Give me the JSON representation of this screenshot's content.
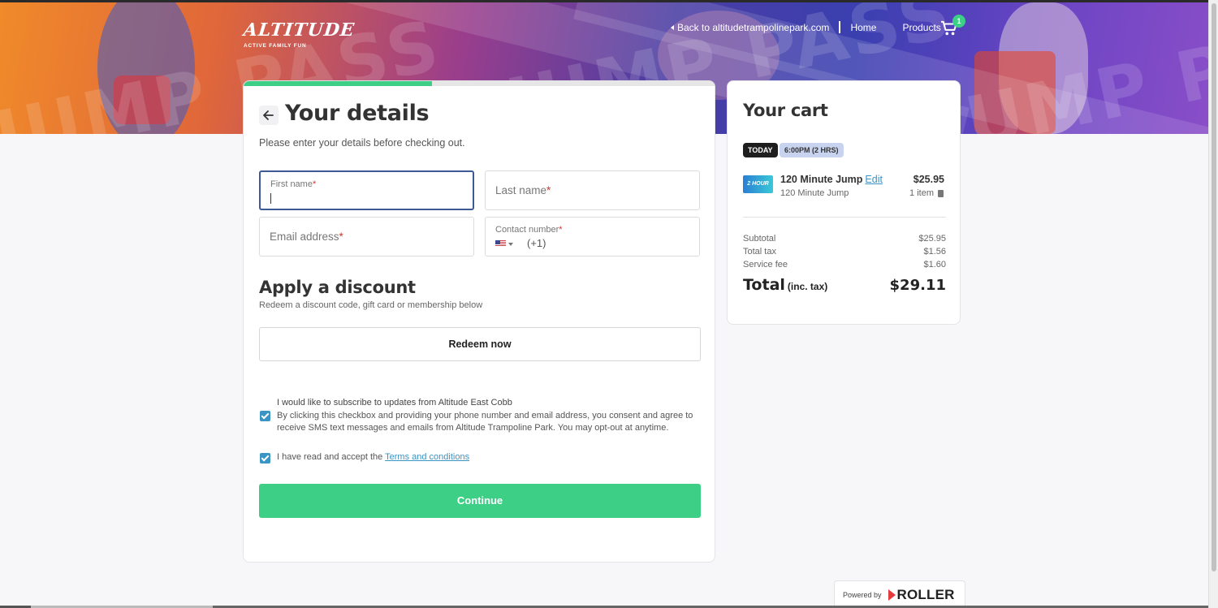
{
  "brand": {
    "logo_text": "ALTITUDE",
    "tagline": "ACTIVE  FAMILY  FUN"
  },
  "hero": {
    "watermark_text": "JUMP PASS"
  },
  "nav": {
    "back_link": "Back to altitudetrampolinepark.com",
    "home": "Home",
    "products": "Products",
    "cart_count": "1",
    "cart_icon": "cart-icon"
  },
  "details": {
    "progress_fraction": 0.4,
    "title": "Your details",
    "subtitle": "Please enter your details before checking out.",
    "first_name_label": "First name",
    "last_name_label": "Last name",
    "email_label": "Email address",
    "contact_label": "Contact number",
    "required_mark": "*",
    "dial_code": "(+1)",
    "first_name_value": ""
  },
  "discount": {
    "title": "Apply a discount",
    "subtitle": "Redeem a discount code, gift card or membership below",
    "redeem_label": "Redeem now"
  },
  "consent": {
    "subscribe_title": "I would like to subscribe to updates from Altitude East Cobb",
    "subscribe_body": "By clicking this checkbox and providing your phone number and email address, you consent and agree to receive SMS text messages and emails from Altitude Trampoline Park. You may opt-out at anytime.",
    "subscribe_checked": true,
    "terms_prefix": "I have read and accept the ",
    "terms_link": "Terms and conditions",
    "terms_checked": true
  },
  "continue_label": "Continue",
  "cart": {
    "title": "Your cart",
    "day_pill": "TODAY",
    "time_pill": "6:00PM (2 HRS)",
    "item": {
      "thumb_text": "2 HOUR",
      "name": "120 Minute Jump",
      "edit": "Edit",
      "sub": "120 Minute Jump",
      "price": "$25.95",
      "qty": "1 item"
    },
    "subtotal_label": "Subtotal",
    "subtotal_value": "$25.95",
    "tax_label": "Total tax",
    "tax_value": "$1.56",
    "fee_label": "Service fee",
    "fee_value": "$1.60",
    "total_label": "Total",
    "total_suffix": "(inc. tax)",
    "total_value": "$29.11"
  },
  "footer": {
    "powered_by": "Powered by",
    "brand": "ROLLER"
  },
  "colors": {
    "accent_green": "#3ecf87",
    "link_blue": "#3a94c4",
    "focus_border": "#3d5a96"
  }
}
